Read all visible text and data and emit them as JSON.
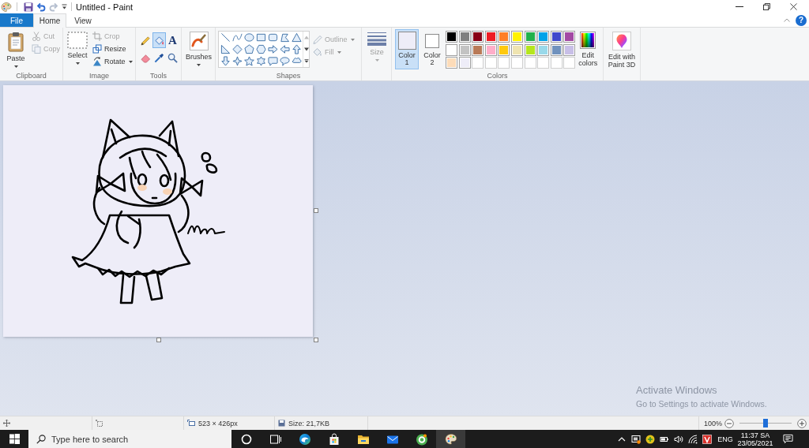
{
  "window": {
    "title": "Untitled - Paint"
  },
  "quick_access": [
    {
      "kind": "save",
      "disabled": false
    },
    {
      "kind": "undo",
      "disabled": false
    },
    {
      "kind": "redo",
      "disabled": true
    }
  ],
  "tabs": [
    {
      "label": "File",
      "kind": "file",
      "selected": false
    },
    {
      "label": "Home",
      "kind": "tab",
      "selected": true
    },
    {
      "label": "View",
      "kind": "tab",
      "selected": false
    }
  ],
  "help": {
    "label": "?"
  },
  "clipboard": {
    "label": "Clipboard",
    "paste": {
      "label": "Paste"
    },
    "actions": [
      {
        "kind": "cut",
        "label": "Cut",
        "disabled": true
      },
      {
        "kind": "copy",
        "label": "Copy",
        "disabled": true
      }
    ]
  },
  "image": {
    "label": "Image",
    "select": {
      "label": "Select"
    },
    "actions": [
      {
        "kind": "crop",
        "label": "Crop",
        "disabled": true
      },
      {
        "kind": "resize",
        "label": "Resize",
        "disabled": false
      },
      {
        "kind": "rotate",
        "label": "Rotate",
        "disabled": false
      }
    ]
  },
  "tools": {
    "label": "Tools",
    "items": [
      {
        "kind": "pencil",
        "selected": false
      },
      {
        "kind": "fill",
        "selected": true
      },
      {
        "kind": "text",
        "glyph": "A",
        "selected": false
      },
      {
        "kind": "eraser",
        "selected": false
      },
      {
        "kind": "picker",
        "selected": false
      },
      {
        "kind": "magnifier",
        "selected": false
      }
    ]
  },
  "brushes": {
    "label": "Brushes"
  },
  "shapes": {
    "label": "Shapes",
    "outline": {
      "label": "Outline",
      "disabled": true
    },
    "fill": {
      "label": "Fill",
      "disabled": true
    }
  },
  "size": {
    "label": "Size",
    "disabled": true
  },
  "colors": {
    "label": "Colors",
    "slots": [
      {
        "label": "Color 1",
        "color": "#eeedf8",
        "selected": true
      },
      {
        "label": "Color 2",
        "color": "#ffffff",
        "selected": false
      }
    ],
    "palette": [
      {
        "kind": "swatch",
        "color": "#000000"
      },
      {
        "kind": "swatch",
        "color": "#7f7f7f"
      },
      {
        "kind": "swatch",
        "color": "#880015"
      },
      {
        "kind": "swatch",
        "color": "#ed1c24"
      },
      {
        "kind": "swatch",
        "color": "#ff7f27"
      },
      {
        "kind": "swatch",
        "color": "#fff200"
      },
      {
        "kind": "swatch",
        "color": "#22b14c"
      },
      {
        "kind": "swatch",
        "color": "#00a2e8"
      },
      {
        "kind": "swatch",
        "color": "#3f48cc"
      },
      {
        "kind": "swatch",
        "color": "#a349a4"
      },
      {
        "kind": "swatch",
        "color": "#ffffff"
      },
      {
        "kind": "swatch",
        "color": "#c3c3c3"
      },
      {
        "kind": "swatch",
        "color": "#b97a57"
      },
      {
        "kind": "swatch",
        "color": "#ffaec9"
      },
      {
        "kind": "swatch",
        "color": "#ffc90e"
      },
      {
        "kind": "swatch",
        "color": "#efe4b0"
      },
      {
        "kind": "swatch",
        "color": "#b5e61d"
      },
      {
        "kind": "swatch",
        "color": "#99d9ea"
      },
      {
        "kind": "swatch",
        "color": "#7092be"
      },
      {
        "kind": "swatch",
        "color": "#c8bfe7"
      },
      {
        "kind": "swatch",
        "color": "#fddcb9"
      },
      {
        "kind": "swatch",
        "color": "#eeedf8"
      },
      {
        "kind": "empty"
      },
      {
        "kind": "empty"
      },
      {
        "kind": "empty"
      },
      {
        "kind": "empty"
      },
      {
        "kind": "empty"
      },
      {
        "kind": "empty"
      },
      {
        "kind": "empty"
      },
      {
        "kind": "empty"
      }
    ],
    "edit": {
      "label": "Edit colors"
    }
  },
  "paint3d": {
    "label": "Edit with Paint 3D"
  },
  "activation_notice": {
    "title": "Activate Windows",
    "message": "Go to Settings to activate Windows."
  },
  "status_bar": {
    "dimensions": "523 × 426px",
    "file_size": "Size: 21,7KB",
    "zoom": "100%",
    "zoom_slider": {
      "level": 0.5
    }
  },
  "taskbar": {
    "search": {
      "placeholder": "Type here to search"
    },
    "apps": [
      {
        "kind": "assistant",
        "selected": false
      },
      {
        "kind": "task_view",
        "selected": false
      },
      {
        "kind": "edge",
        "selected": false
      },
      {
        "kind": "store",
        "selected": false
      },
      {
        "kind": "explorer",
        "selected": false
      },
      {
        "kind": "mail",
        "selected": false
      },
      {
        "kind": "browser",
        "selected": false
      },
      {
        "kind": "paint",
        "selected": true
      }
    ],
    "tray": {
      "language": "ENG",
      "time": "11:37 SA",
      "date": "23/05/2021"
    }
  }
}
